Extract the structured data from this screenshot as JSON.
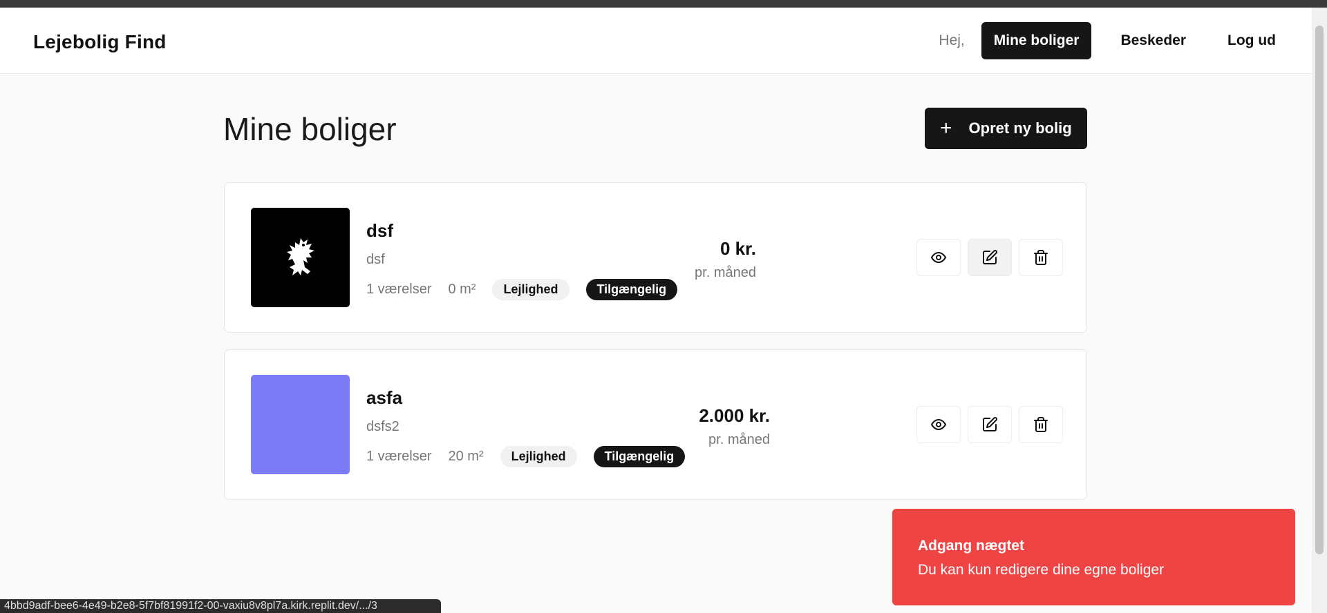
{
  "app": {
    "title": "Lejebolig Find"
  },
  "nav": {
    "greeting": "Hej,",
    "my_properties": "Mine boliger",
    "messages": "Beskeder",
    "logout": "Log ud"
  },
  "page": {
    "title": "Mine boliger",
    "create_button": "Opret ny bolig",
    "create_icon": "plus-icon"
  },
  "listings": [
    {
      "title": "dsf",
      "subtitle": "dsf",
      "rooms": "1 værelser",
      "area": "0 m²",
      "type": "Lejlighed",
      "status": "Tilgængelig",
      "price": "0 kr.",
      "price_unit": "pr. måned",
      "image": "griffin-logo",
      "image_color": "#000000"
    },
    {
      "title": "asfa",
      "subtitle": "dsfs2",
      "rooms": "1 værelser",
      "area": "20 m²",
      "type": "Lejlighed",
      "status": "Tilgængelig",
      "price": "2.000 kr.",
      "price_unit": "pr. måned",
      "image": "placeholder",
      "image_color": "#7c7cf9"
    }
  ],
  "actions": {
    "view_icon": "eye-icon",
    "edit_icon": "edit-icon",
    "delete_icon": "trash-icon"
  },
  "toast": {
    "title": "Adgang nægtet",
    "message": "Du kan kun redigere dine egne boliger",
    "color": "#ef4444"
  },
  "status_bar": {
    "url": "4bbd9adf-bee6-4e49-b2e8-5f7bf81991f2-00-vaxiu8v8pl7a.kirk.replit.dev/.../3"
  },
  "colors": {
    "accent": "#161616",
    "background": "#fafafa"
  }
}
